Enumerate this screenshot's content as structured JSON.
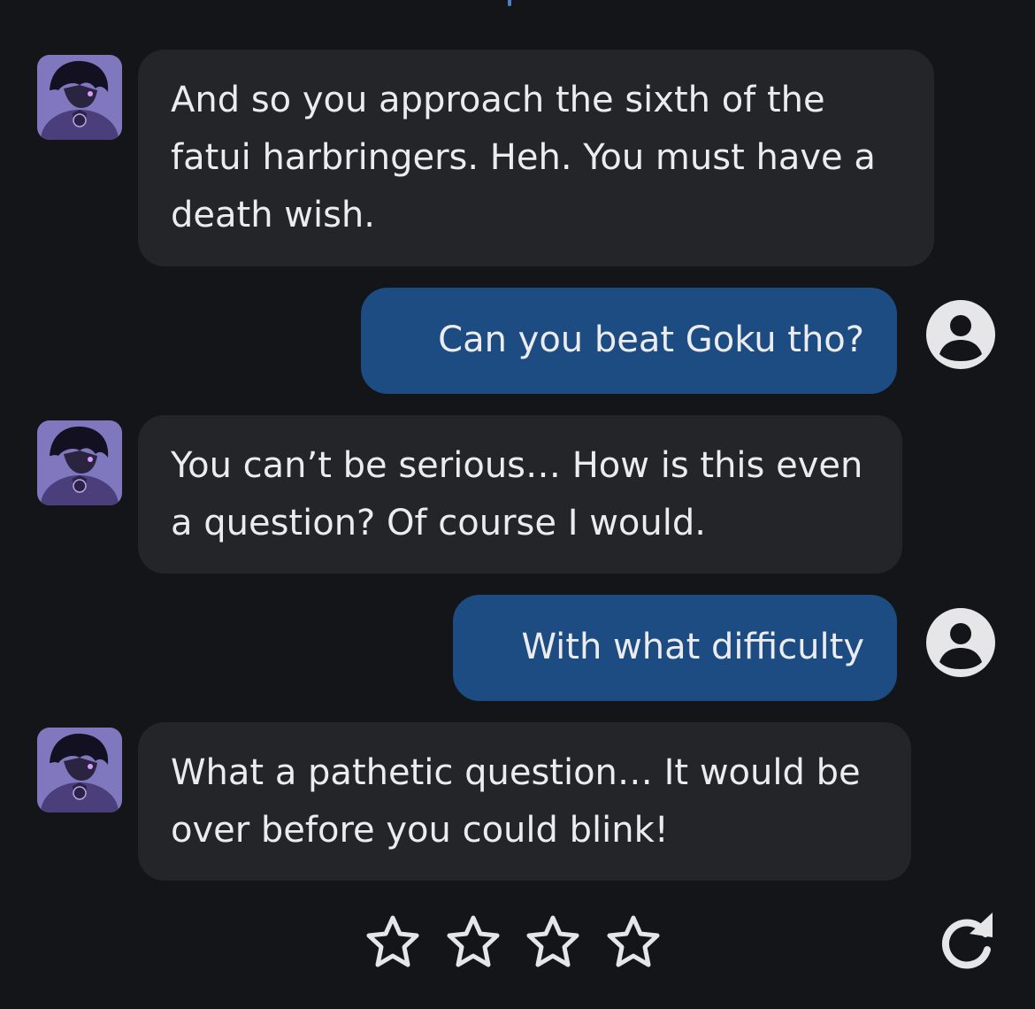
{
  "messages": [
    {
      "role": "bot",
      "text": "And so you approach the sixth of the fatui harbringers. Heh. You must have a death wish."
    },
    {
      "role": "user",
      "text": "Can you beat Goku tho?"
    },
    {
      "role": "bot",
      "text": "You can’t be serious… How is this even a question? Of course I would."
    },
    {
      "role": "user",
      "text": "With what difficulty"
    },
    {
      "role": "bot",
      "text": "What a pathetic question… It would be over before you could blink!"
    }
  ],
  "icons": {
    "bot_avatar": "character-avatar",
    "user_avatar": "user-circle-icon",
    "rating_star": "star-outline-icon",
    "regenerate": "refresh-icon"
  },
  "rating": {
    "max": 4,
    "value": 0
  },
  "colors": {
    "background": "#141518",
    "bot_bubble": "#232529",
    "user_bubble": "#1d4c83",
    "text": "#ececef",
    "icon": "#e6e6e9"
  }
}
